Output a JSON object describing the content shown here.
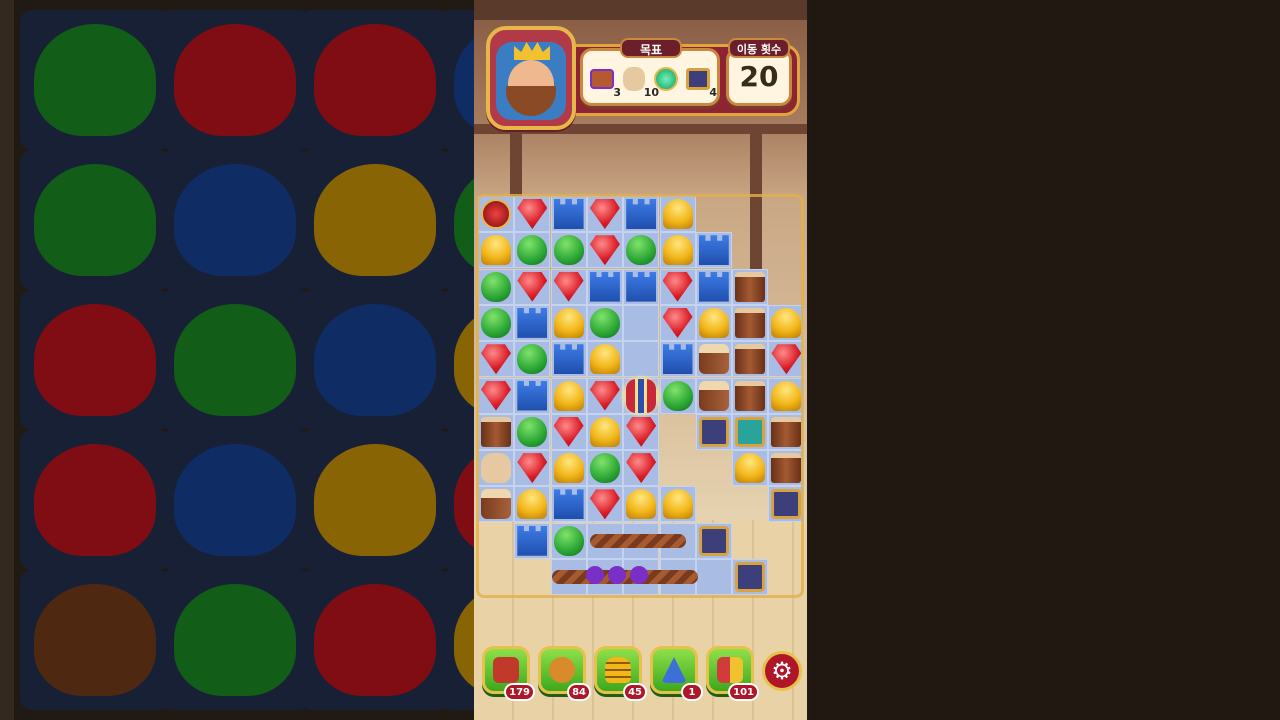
{
  "goal": {
    "title": "목표",
    "items": [
      {
        "icon": "flower-chest-icon",
        "count": "3"
      },
      {
        "icon": "cat-statue-icon",
        "count": "10"
      },
      {
        "icon": "green-gem-icon",
        "count": ""
      },
      {
        "icon": "crate-icon",
        "count": "4"
      }
    ]
  },
  "moves": {
    "title": "이동 횟수",
    "value": "20"
  },
  "boosters": [
    {
      "icon": "hammer-chest-icon",
      "count": "179"
    },
    {
      "icon": "cannon-icon",
      "count": "84"
    },
    {
      "icon": "beehive-icon",
      "count": "45"
    },
    {
      "icon": "wizard-hat-icon",
      "count": "1"
    },
    {
      "icon": "jester-hammer-icon",
      "count": "101"
    }
  ],
  "settings": {
    "icon": "gear-icon",
    "glyph": "⚙"
  },
  "colors": {
    "board_cell": "#a9bce4",
    "frame_gold": "#e2b04a",
    "booster_green": "#3ea81d",
    "badge_red": "#b0162a"
  }
}
